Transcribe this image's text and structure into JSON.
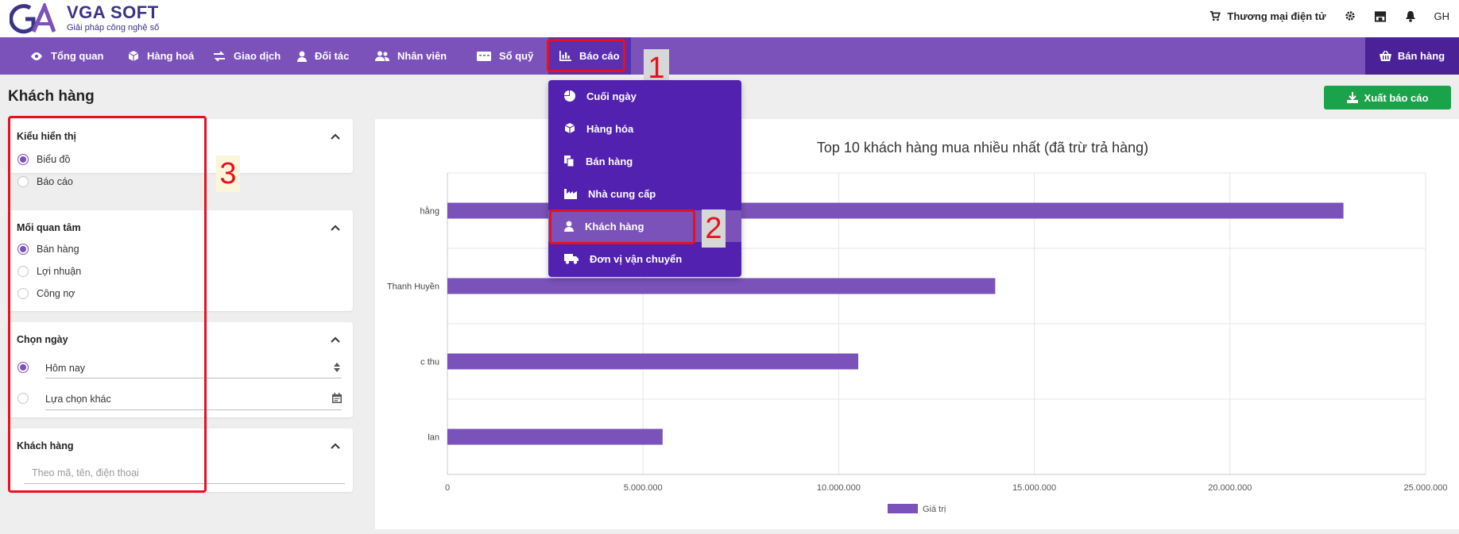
{
  "brand": {
    "name": "VGA SOFT",
    "tagline": "Giải pháp công nghệ số",
    "logo_text": "GA"
  },
  "topbar": {
    "ecommerce_label": "Thương mại điện tử",
    "user_initials": "GH"
  },
  "nav": {
    "items": [
      {
        "label": "Tổng quan",
        "icon": "eye-icon"
      },
      {
        "label": "Hàng hoá",
        "icon": "box-icon"
      },
      {
        "label": "Giao dịch",
        "icon": "exchange-icon"
      },
      {
        "label": "Đối tác",
        "icon": "person-icon"
      },
      {
        "label": "Nhân viên",
        "icon": "users-icon"
      },
      {
        "label": "Sổ quỹ",
        "icon": "money-icon"
      },
      {
        "label": "Báo cáo",
        "icon": "bar-chart-icon"
      }
    ],
    "sell_button": "Bán hàng"
  },
  "page": {
    "title": "Khách hàng",
    "export_button": "Xuất báo cáo"
  },
  "filters": {
    "display": {
      "title": "Kiểu hiển thị",
      "options": [
        "Biểu đồ",
        "Báo cáo"
      ],
      "selected": 0
    },
    "concern": {
      "title": "Mối quan tâm",
      "options": [
        "Bán hàng",
        "Lợi nhuận",
        "Công nợ"
      ],
      "selected": 0
    },
    "date": {
      "title": "Chọn ngày",
      "today": "Hôm nay",
      "other": "Lựa chọn khác"
    },
    "customer": {
      "title": "Khách hàng",
      "placeholder": "Theo mã, tên, điện thoại"
    }
  },
  "dropdown": {
    "items": [
      {
        "label": "Cuối ngày",
        "icon": "pie-icon"
      },
      {
        "label": "Hàng hóa",
        "icon": "box-icon"
      },
      {
        "label": "Bán hàng",
        "icon": "copy-icon"
      },
      {
        "label": "Nhà cung cấp",
        "icon": "factory-icon"
      },
      {
        "label": "Khách hàng",
        "icon": "person-icon"
      },
      {
        "label": "Đơn vị vận chuyển",
        "icon": "truck-icon"
      }
    ],
    "highlighted": 4
  },
  "annotations": [
    "1",
    "2",
    "3"
  ],
  "colors": {
    "primary": "#7b52b9",
    "nav_dark": "#4a2196",
    "dropdown": "#5321b0",
    "export": "#1aa34a",
    "annotation": "#e8101e"
  },
  "chart_data": {
    "type": "bar",
    "orientation": "horizontal",
    "title": "Top 10 khách hàng mua nhiều nhất (đã trừ trả hàng)",
    "categories": [
      "hằng",
      "Thanh Huyền",
      "c thu",
      "lan"
    ],
    "series": [
      {
        "name": "Giá trị",
        "values": [
          22900000,
          14000000,
          10500000,
          5500000
        ]
      }
    ],
    "xlim": [
      0,
      25000000
    ],
    "xticks": [
      "0",
      "5.000.000",
      "10.000.000",
      "15.000.000",
      "20.000.000",
      "25.000.000"
    ],
    "grid": true,
    "legend": "bottom",
    "color": "#7b52b9"
  }
}
